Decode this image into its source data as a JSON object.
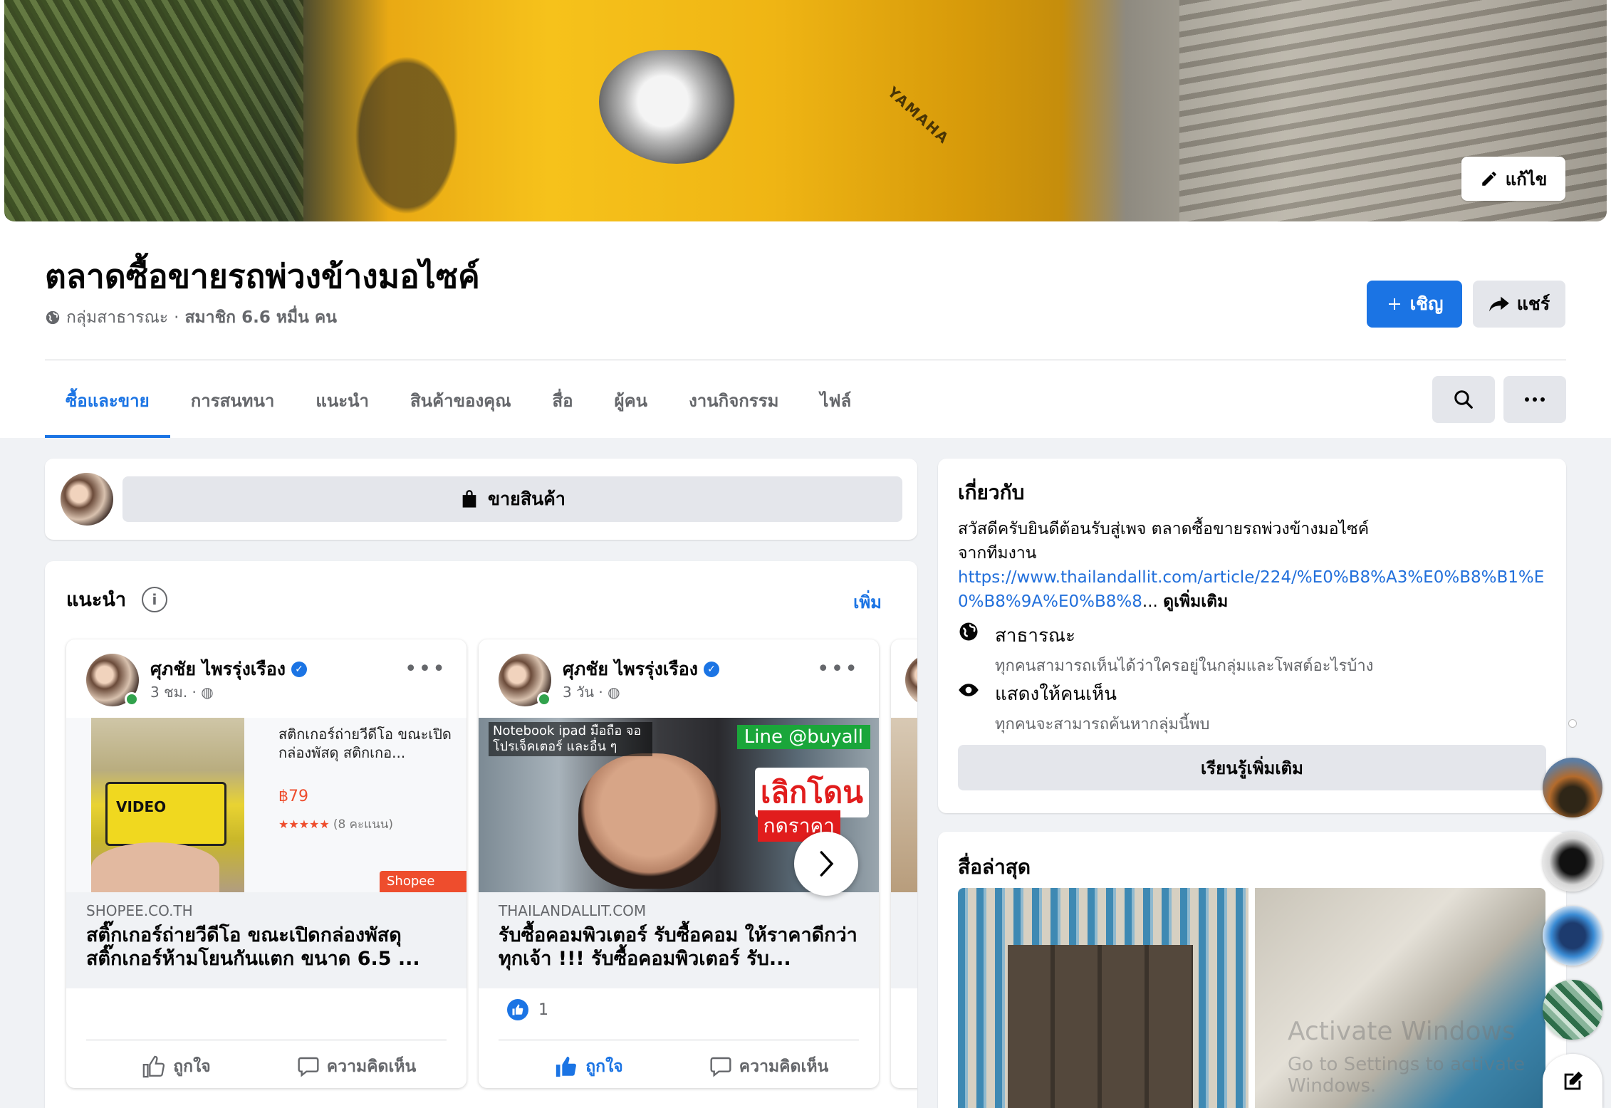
{
  "cover": {
    "brand_text": "YAMAHA",
    "edit_label": "แก้ไข"
  },
  "group": {
    "name": "ตลาดซื้อขายรถพ่วงข้างมอไซค์",
    "privacy": "กลุ่มสาธารณะ",
    "members": "สมาชิก 6.6 หมื่น คน"
  },
  "header_actions": {
    "invite_label": "เชิญ",
    "share_label": "แชร์"
  },
  "tabs": [
    {
      "label": "ซื้อและขาย",
      "active": true
    },
    {
      "label": "การสนทนา"
    },
    {
      "label": "แนะนำ"
    },
    {
      "label": "สินค้าของคุณ"
    },
    {
      "label": "สื่อ"
    },
    {
      "label": "ผู้คน"
    },
    {
      "label": "งานกิจกรรม"
    },
    {
      "label": "ไฟล์"
    }
  ],
  "sell": {
    "button_label": "ขายสินค้า"
  },
  "recommended": {
    "title": "แนะนำ",
    "info_glyph": "i",
    "more_label": "เพิ่ม",
    "posts": [
      {
        "author": "ศุภชัย ไพรรุ่งเรือง",
        "time": "3 ชม. ·",
        "product_text": "สติกเกอร์ถ่ายวีดีโอ ขณะเปิดกล่องพัสดุ สติกเกอ...",
        "price": "฿79",
        "stars": "★★★★★",
        "rating": "(8 คะแนน)",
        "shop_badge": "Shopee",
        "image_label": "VIDEO",
        "domain": "SHOPEE.CO.TH",
        "title": "สติ๊กเกอร์ถ่ายวีดีโอ ขณะเปิดกล่องพัสดุ สติ๊กเกอร์ห้ามโยนกันแตก ขนาด 6.5 ...",
        "like_label": "ถูกใจ",
        "comment_label": "ความคิดเห็น"
      },
      {
        "author": "ศุภชัย ไพรรุ่งเรือง",
        "time": "3 วัน ·",
        "overlay_top": "Notebook ipad มือถือ จอ โปรเจ็คเตอร์ และอื่น ๆ",
        "overlay_line": "Line @buyall",
        "overlay_stop": "เลิกโดน",
        "overlay_price": "กดราคา",
        "domain": "THAILANDALLIT.COM",
        "title": "รับซื้อคอมพิวเตอร์ รับซื้อคอม ให้ราคาดีกว่าทุกเจ้า !!! รับซื้อคอมพิวเตอร์ รับ...",
        "like_count": "1",
        "like_label": "ถูกใจ",
        "comment_label": "ความคิดเห็น"
      }
    ]
  },
  "about": {
    "title": "เกี่ยวกับ",
    "desc_line1": "สวัสดีครับยินดีต้อนรับสู่เพจ ตลาดซื้อขายรถพ่วงข้างมอไซค์",
    "desc_line2": "จากทีมงาน",
    "url": "https://www.thailandallit.com/article/224/%E0%B8%A3%E0%B8%B1%E0%B8%9A%E0%B8%8",
    "ellipsis": "...",
    "see_more": "ดูเพิ่มเติม",
    "public_title": "สาธารณะ",
    "public_desc": "ทุกคนสามารถเห็นได้ว่าใครอยู่ในกลุ่มและโพสต์อะไรบ้าง",
    "visible_title": "แสดงให้คนเห็น",
    "visible_desc": "ทุกคนจะสามารถค้นหากลุ่มนี้พบ",
    "learn_more": "เรียนรู้เพิ่มเติม"
  },
  "media": {
    "title": "สื่อล่าสุด"
  },
  "watermark": {
    "line1": "Activate Windows",
    "line2": "Go to Settings to activate Windows."
  },
  "colors": {
    "accent": "#1b74e4",
    "background": "#f0f2f5",
    "secondary_text": "#65676b"
  }
}
